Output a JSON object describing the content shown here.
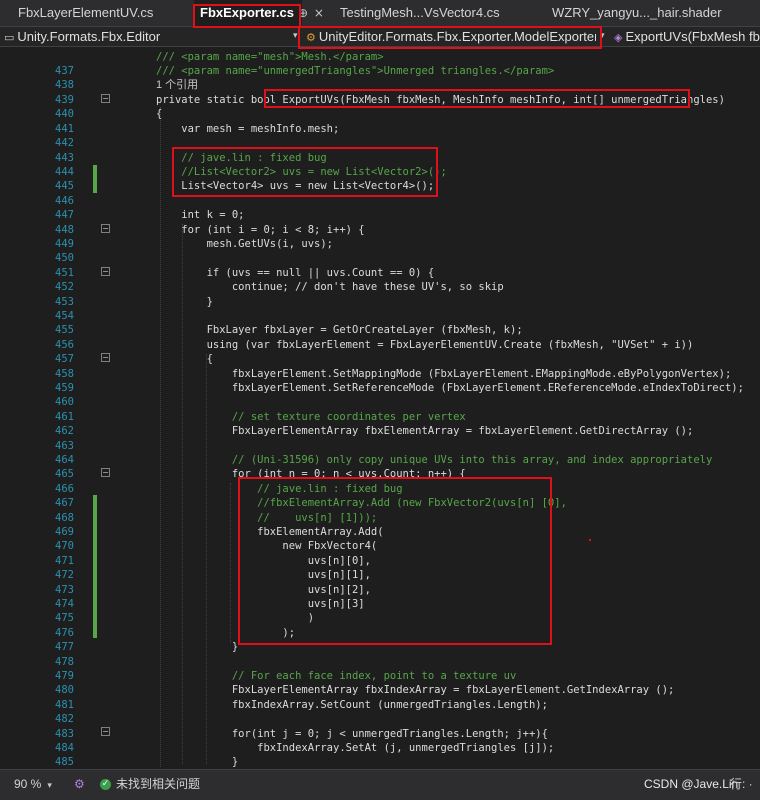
{
  "tabs": [
    {
      "label": "FbxLayerElementUV.cs",
      "active": false
    },
    {
      "label": "FbxExporter.cs",
      "active": true
    },
    {
      "label": "TestingMesh...VsVector4.cs",
      "active": false
    },
    {
      "label": "WZRY_yangyu..._hair.shader",
      "active": false
    }
  ],
  "tab_icons": {
    "pin": "⊕",
    "close": "×"
  },
  "navbar": {
    "project": "Unity.Formats.Fbx.Editor",
    "class": "UnityEditor.Formats.Fbx.Exporter.ModelExporter",
    "member": "ExportUVs(FbxMesh fbxMesh, MeshInfo meshInfo, int[] unmergedTriangles)"
  },
  "editor": {
    "reference_hint": "1 个引用",
    "line_numbers": [
      "437",
      "438",
      "",
      "439",
      "440",
      "441",
      "442",
      "443",
      "444",
      "445",
      "446",
      "447",
      "448",
      "449",
      "450",
      "451",
      "452",
      "453",
      "454",
      "455",
      "456",
      "457",
      "458",
      "459",
      "460",
      "461",
      "462",
      "463",
      "464",
      "465",
      "466",
      "467",
      "468",
      "469",
      "470",
      "471",
      "472",
      "473",
      "474",
      "475",
      "476",
      "477",
      "478",
      "479",
      "480",
      "481",
      "482",
      "483",
      "484",
      "485"
    ],
    "lines": [
      "/// <param name=\"mesh\">Mesh.</param>",
      "/// <param name=\"unmergedTriangles\">Unmerged triangles.</param>",
      "",
      "private static bool ExportUVs(FbxMesh fbxMesh, MeshInfo meshInfo, int[] unmergedTriangles)",
      "{",
      "    var mesh = meshInfo.mesh;",
      "",
      "    // jave.lin : fixed bug",
      "    //List<Vector2> uvs = new List<Vector2>();",
      "    List<Vector4> uvs = new List<Vector4>();",
      "",
      "    int k = 0;",
      "    for (int i = 0; i < 8; i++) {",
      "        mesh.GetUVs(i, uvs);",
      "",
      "        if (uvs == null || uvs.Count == 0) {",
      "            continue; // don't have these UV's, so skip",
      "        }",
      "",
      "        FbxLayer fbxLayer = GetOrCreateLayer (fbxMesh, k);",
      "        using (var fbxLayerElement = FbxLayerElementUV.Create (fbxMesh, \"UVSet\" + i))",
      "        {",
      "            fbxLayerElement.SetMappingMode (FbxLayerElement.EMappingMode.eByPolygonVertex);",
      "            fbxLayerElement.SetReferenceMode (FbxLayerElement.EReferenceMode.eIndexToDirect);",
      "",
      "            // set texture coordinates per vertex",
      "            FbxLayerElementArray fbxElementArray = fbxLayerElement.GetDirectArray ();",
      "",
      "            // (Uni-31596) only copy unique UVs into this array, and index appropriately",
      "            for (int n = 0; n < uvs.Count; n++) {",
      "                // jave.lin : fixed bug",
      "                //fbxElementArray.Add (new FbxVector2(uvs[n] [0],",
      "                //    uvs[n] [1]));",
      "                fbxElementArray.Add(",
      "                    new FbxVector4(",
      "                        uvs[n][0],",
      "                        uvs[n][1],",
      "                        uvs[n][2],",
      "                        uvs[n][3]",
      "                        )",
      "                    );",
      "            }",
      "",
      "            // For each face index, point to a texture uv",
      "            FbxLayerElementArray fbxIndexArray = fbxLayerElement.GetIndexArray ();",
      "            fbxIndexArray.SetCount (unmergedTriangles.Length);",
      "",
      "            for(int j = 0; j < unmergedTriangles.Length; j++){",
      "                fbxIndexArray.SetAt (j, unmergedTriangles [j]);",
      "            }"
    ]
  },
  "statusbar": {
    "zoom": "90 %",
    "issues": "未找到相关问题",
    "position": "行: ·",
    "watermark": "CSDN @Jave.Lin"
  },
  "colors": {
    "highlight_box": "#e0101a",
    "comment": "#57a64a",
    "keyword": "#569cd6",
    "type": "#4ec9b0",
    "method": "#dcdcaa",
    "line_number": "#2b91af",
    "change_marker": "#57a64a"
  }
}
